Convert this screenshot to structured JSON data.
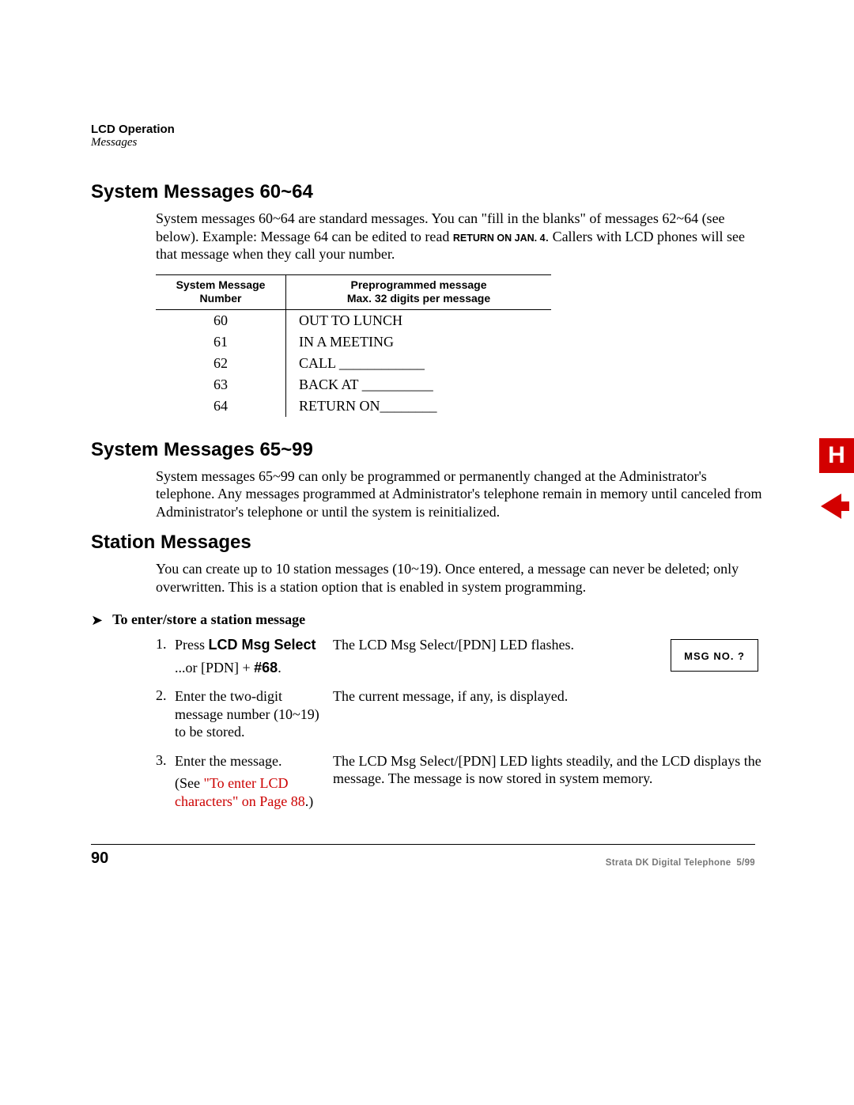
{
  "header": {
    "line1": "LCD Operation",
    "line2": "Messages"
  },
  "section1": {
    "title": "System Messages 60~64",
    "para_pre": "System messages 60~64 are standard messages. You can \"fill in the blanks\" of messages 62~64 (see below). Example: Message 64 can be edited to read ",
    "para_bold": "RETURN ON JAN. 4",
    "para_post": ". Callers with LCD phones will see that message when they call your number.",
    "table": {
      "head_left_l1": "System Message",
      "head_left_l2": "Number",
      "head_right_l1": "Preprogrammed message",
      "head_right_l2": "Max. 32 digits per message",
      "rows": [
        {
          "num": "60",
          "msg": "OUT TO LUNCH"
        },
        {
          "num": "61",
          "msg": "IN A MEETING"
        },
        {
          "num": "62",
          "msg": "CALL ____________"
        },
        {
          "num": "63",
          "msg": "BACK AT __________"
        },
        {
          "num": "64",
          "msg": "RETURN ON________"
        }
      ]
    }
  },
  "section2": {
    "title": "System Messages 65~99",
    "para": "System messages 65~99 can only be programmed or permanently changed at the Administrator's telephone. Any messages programmed at Administrator's telephone remain in memory until canceled from Administrator's telephone or until the system is reinitialized."
  },
  "section3": {
    "title": "Station Messages",
    "para": "You can create up to 10 station messages (10~19). Once entered, a message can never be deleted; only overwritten. This is a station option that is enabled in system programming.",
    "procTitle": "To enter/store a station message",
    "steps": {
      "s1": {
        "num": "1.",
        "left_p1_pre": "Press ",
        "left_p1_bold": "LCD Msg Select",
        "left_p2_pre": "...or [PDN] + ",
        "left_p2_bold": "#68",
        "left_p2_post": ".",
        "right": "The LCD Msg Select/[PDN] LED flashes.",
        "lcd": "MSG  NO. ?"
      },
      "s2": {
        "num": "2.",
        "left": "Enter the two-digit message number (10~19) to be stored.",
        "right": "The current message, if any, is displayed."
      },
      "s3": {
        "num": "3.",
        "leftA": "Enter the message.",
        "leftB_pre": "(See ",
        "leftB_link": "\"To enter LCD characters\" on Page 88",
        "leftB_post": ".)",
        "right": "The LCD Msg Select/[PDN] LED lights steadily, and the LCD displays the message. The message is now stored in system memory."
      }
    }
  },
  "side": {
    "letter": "H"
  },
  "footer": {
    "pageNumber": "90",
    "doc": "Strata DK Digital Telephone",
    "date": "5/99"
  }
}
